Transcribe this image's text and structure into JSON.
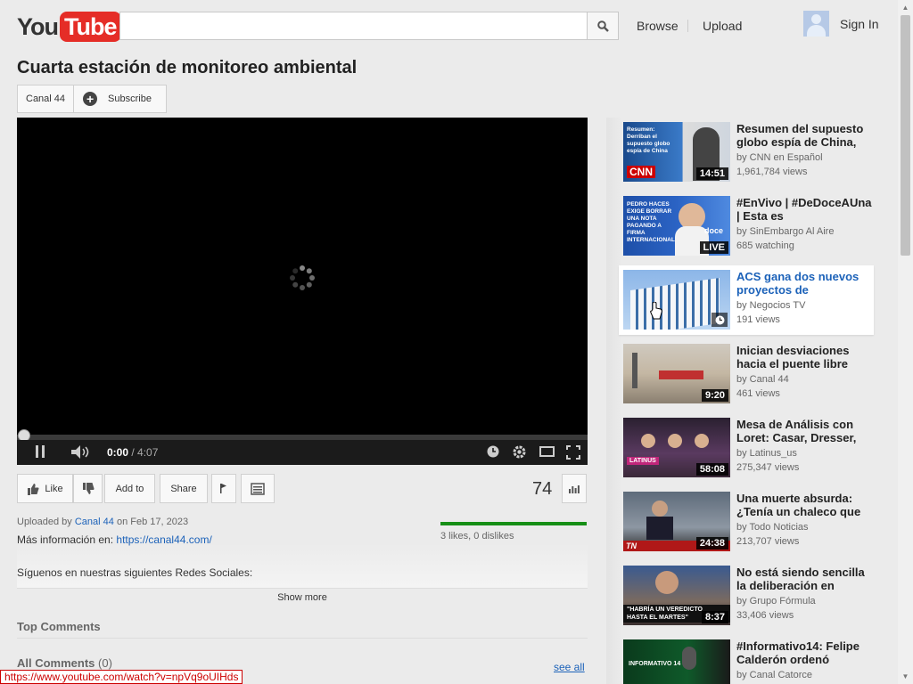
{
  "header": {
    "logo_you": "You",
    "logo_tube": "Tube",
    "search_placeholder": "",
    "browse": "Browse",
    "upload": "Upload",
    "sign_in": "Sign In"
  },
  "video": {
    "title": "Cuarta estación de monitoreo ambiental",
    "channel": "Canal 44",
    "subscribe": "Subscribe",
    "time_current": "0:00",
    "time_duration": "/ 4:07",
    "progress": 0
  },
  "actions": {
    "like": "Like",
    "add_to": "Add to",
    "share": "Share",
    "view_count": "74"
  },
  "details": {
    "uploaded_prefix": "Uploaded by",
    "uploader": "Canal 44",
    "uploaded_date": "on Feb 17, 2023",
    "more_info_prefix": "Más información en:",
    "more_info_link": "https://canal44.com/",
    "likes_text": "3 likes, 0 dislikes",
    "likes_ratio": 1.0,
    "description_line": "Síguenos en nuestras siguientes Redes Sociales:",
    "show_more": "Show more"
  },
  "comments": {
    "top_heading": "Top Comments",
    "all_heading": "All Comments",
    "all_count": "(0)",
    "see_all": "see all"
  },
  "status_bar_url": "https://www.youtube.com/watch?v=npVq9oUIHds",
  "recommendations": [
    {
      "title": "Resumen del supuesto globo espía de China,",
      "by": "by CNN en Español",
      "views": "1,961,784 views",
      "duration": "14:51",
      "thumb_text": "Resumen: Derriban el supuesto globo espía de China",
      "brand": "CNN"
    },
    {
      "title": "#EnVivo | #DeDoceAUna | Esta es",
      "by": "by SinEmbargo Al Aire",
      "views": "685 watching",
      "duration": "LIVE",
      "thumb_text": "PEDRO HACES EXIGE BORRAR UNA NOTA PAGANDO A FIRMA INTERNACIONAL",
      "brand": "doce"
    },
    {
      "title": "ACS gana dos nuevos proyectos de",
      "by": "by Negocios TV",
      "views": "191 views",
      "duration": ""
    },
    {
      "title": "Inician desviaciones hacia el puente libre",
      "by": "by Canal 44",
      "views": "461 views",
      "duration": "9:20"
    },
    {
      "title": "Mesa de Análisis con Loret: Casar, Dresser,",
      "by": "by Latinus_us",
      "views": "275,347 views",
      "duration": "58:08",
      "brand": "LATINUS"
    },
    {
      "title": "Una muerte absurda: ¿Tenía un chaleco que",
      "by": "by Todo Noticias",
      "views": "213,707 views",
      "duration": "24:38",
      "brand": "TN"
    },
    {
      "title": "No está siendo sencilla la deliberación en",
      "by": "by Grupo Fórmula",
      "views": "33,406 views",
      "duration": "8:37",
      "thumb_text": "\"HABRÍA UN VEREDICTO HASTA EL MARTES\""
    },
    {
      "title": "#Informativo14: Felipe Calderón ordenó",
      "by": "by Canal Catorce",
      "views": "",
      "duration": "",
      "thumb_text": "INFORMATIVO 14"
    }
  ]
}
